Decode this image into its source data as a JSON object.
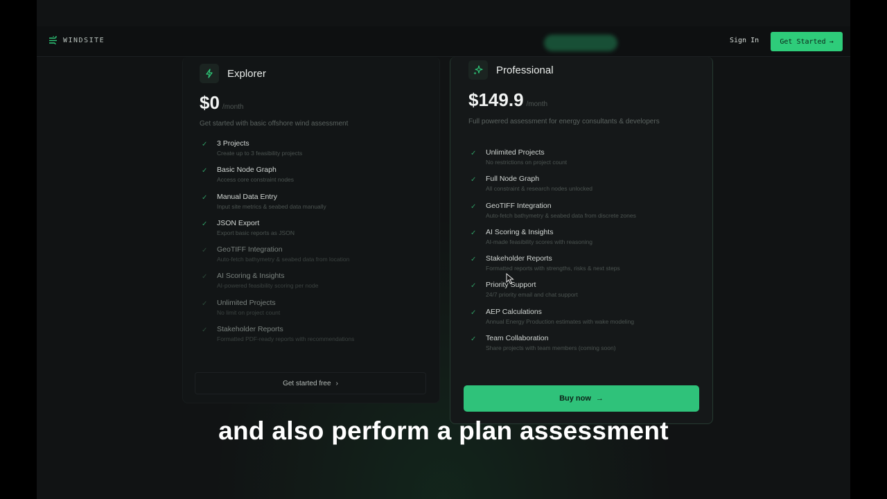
{
  "header": {
    "logo_text": "WINDSITE",
    "sign_in": "Sign In",
    "get_started": "Get Started",
    "get_started_arrow": "→"
  },
  "plans": {
    "explorer": {
      "name": "Explorer",
      "price": "$0",
      "period": "/month",
      "description": "Get started with basic offshore wind assessment",
      "features": [
        {
          "title": "3 Projects",
          "sub": "Create up to 3 feasibility projects"
        },
        {
          "title": "Basic Node Graph",
          "sub": "Access core constraint nodes"
        },
        {
          "title": "Manual Data Entry",
          "sub": "Input site metrics & seabed data manually"
        },
        {
          "title": "JSON Export",
          "sub": "Export basic reports as JSON"
        },
        {
          "title": "GeoTIFF Integration",
          "sub": "Auto-fetch bathymetry & seabed data from location"
        },
        {
          "title": "AI Scoring & Insights",
          "sub": "AI-powered feasibility scoring per node"
        },
        {
          "title": "Unlimited Projects",
          "sub": "No limit on project count"
        },
        {
          "title": "Stakeholder Reports",
          "sub": "Formatted PDF-ready reports with recommendations"
        }
      ],
      "button_label": "Get started free",
      "button_arrow": "›"
    },
    "professional": {
      "name": "Professional",
      "price": "$149.9",
      "period": "/month",
      "description": "Full powered assessment for energy consultants & developers",
      "features": [
        {
          "title": "Unlimited Projects",
          "sub": "No restrictions on project count"
        },
        {
          "title": "Full Node Graph",
          "sub": "All constraint & research nodes unlocked"
        },
        {
          "title": "GeoTIFF Integration",
          "sub": "Auto-fetch bathymetry & seabed data from discrete zones"
        },
        {
          "title": "AI Scoring & Insights",
          "sub": "AI-made feasibility scores with reasoning"
        },
        {
          "title": "Stakeholder Reports",
          "sub": "Formatted reports with strengths, risks & next steps"
        },
        {
          "title": "Priority Support",
          "sub": "24/7 priority email and chat support"
        },
        {
          "title": "AEP Calculations",
          "sub": "Annual Energy Production estimates with wake modeling"
        },
        {
          "title": "Team Collaboration",
          "sub": "Share projects with team members (coming soon)"
        }
      ],
      "button_label": "Buy now",
      "button_arrow": "→"
    }
  },
  "caption": "and also perform a plan assessment",
  "colors": {
    "accent": "#2ecc7a",
    "background": "#111314",
    "card": "#151819"
  }
}
